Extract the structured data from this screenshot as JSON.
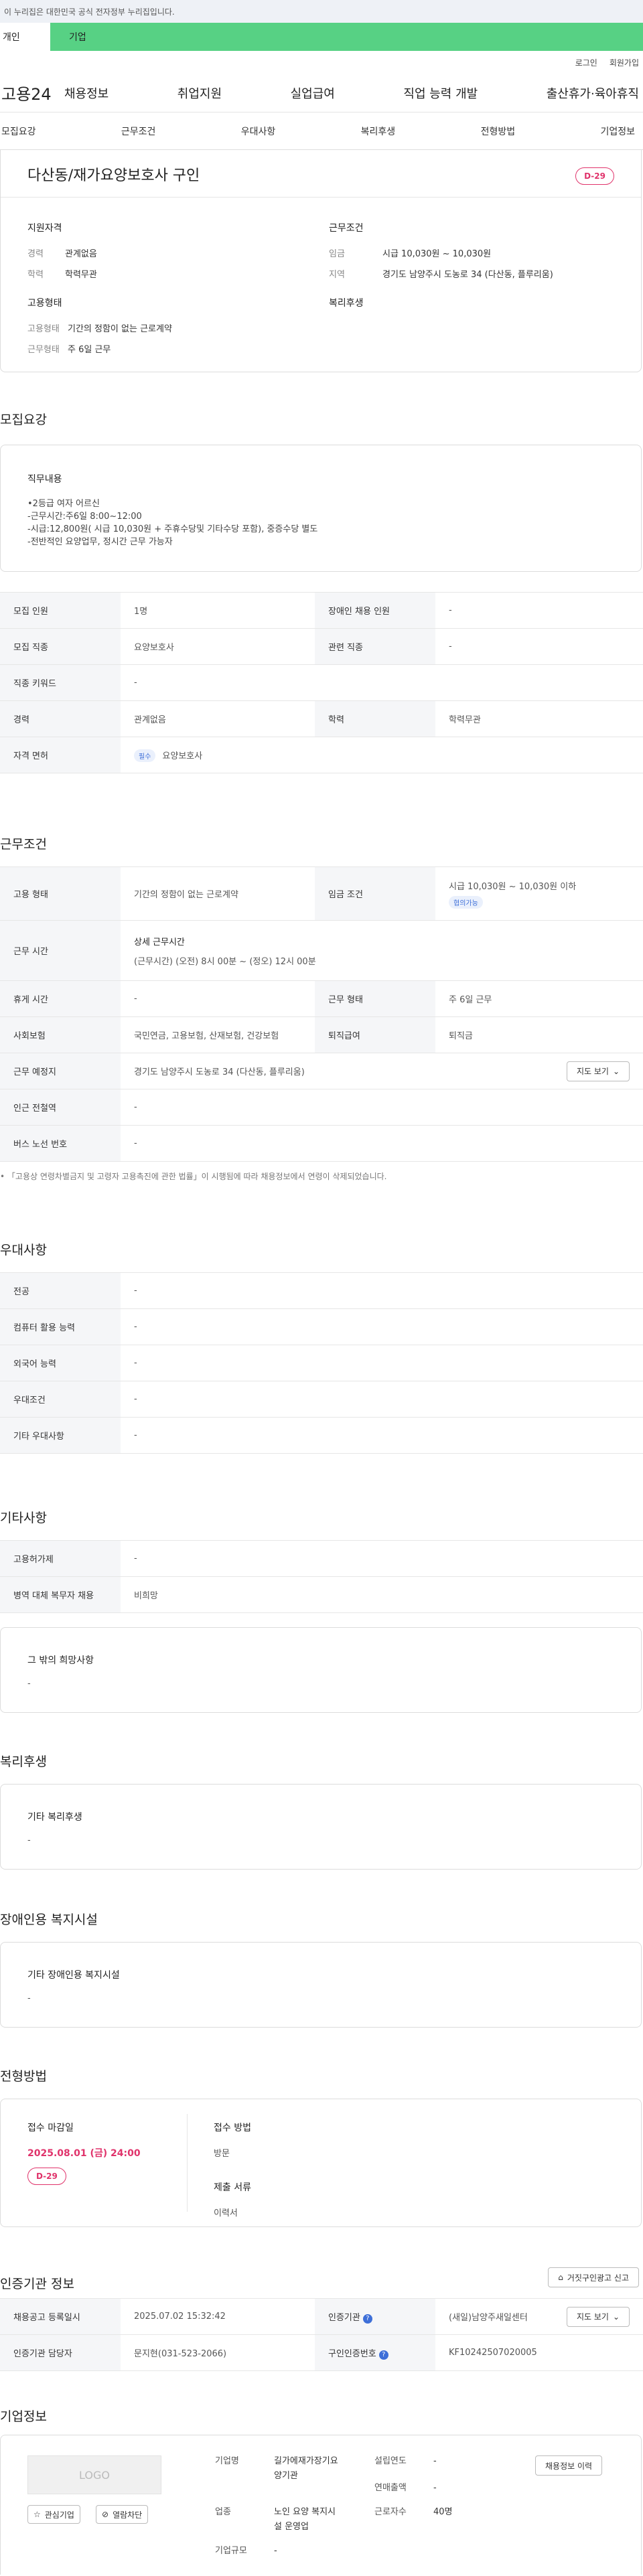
{
  "gov_banner": "이 누리집은 대한민국 공식 전자정부 누리집입니다.",
  "tabs": [
    "개인",
    "기업"
  ],
  "util": [
    "로그인",
    "회원가입"
  ],
  "logo": "고용24",
  "gnb": [
    "채용정보",
    "취업지원",
    "실업급여",
    "직업 능력 개발",
    "출산휴가·육아휴직"
  ],
  "snb": [
    "모집요강",
    "근무조건",
    "우대사항",
    "복리후생",
    "전형방법",
    "기업정보"
  ],
  "summary": {
    "title": "다산동/재가요양보호사 구인",
    "dday": "D-29",
    "qual_title": "지원자격",
    "career_k": "경력",
    "career_v": "관계없음",
    "edu_k": "학력",
    "edu_v": "학력무관",
    "emp_title": "고용형태",
    "emptype_k": "고용형태",
    "emptype_v": "기간의 정함이 없는 근로계약",
    "worktype_k": "근무형태",
    "worktype_v": "주 6일 근무",
    "cond_title": "근무조건",
    "wage_k": "임금",
    "wage_v": "시급 10,030원 ~ 10,030원",
    "region_k": "지역",
    "region_v": "경기도 남양주시 도농로 34 (다산동, 플루리움)",
    "welfare_title": "복리후생"
  },
  "recruit": {
    "heading": "모집요강",
    "duty_title": "직무내용",
    "duty_lines": [
      "•2등급 여자 어르신",
      "-근무시간:주6일 8:00~12:00",
      "-시급:12,800원( 시급 10,030원 + 주휴수당및 기타수당 포함), 중증수당 별도",
      "-전반적인 요양업무, 정시간 근무 가능자"
    ],
    "rows": [
      [
        "모집 인원",
        "1명",
        "장애인 채용 인원",
        "-"
      ],
      [
        "모집 직종",
        "요양보호사",
        "관련 직종",
        "-"
      ],
      [
        "직종 키워드",
        "-"
      ],
      [
        "경력",
        "관계없음",
        "학력",
        "학력무관"
      ],
      [
        "자격 면허",
        "요양보호사"
      ]
    ],
    "license_pill": "필수"
  },
  "work": {
    "heading": "근무조건",
    "emptype_h": "고용 형태",
    "emptype_v": "기간의 정함이 없는 근로계약",
    "wage_h": "임금 조건",
    "wage_v": "시급 10,030원 ~ 10,030원 이하",
    "wage_pill": "협의가능",
    "hours_h": "근무 시간",
    "hours_t": "상세 근무시간",
    "hours_v": "(근무시간) (오전) 8시 00분 ~ (정오) 12시 00분",
    "break_h": "휴게 시간",
    "break_v": "-",
    "form_h": "근무 형태",
    "form_v": "주 6일 근무",
    "ins_h": "사회보험",
    "ins_v": "국민연금, 고용보험, 산재보험, 건강보험",
    "ret_h": "퇴직급여",
    "ret_v": "퇴직금",
    "place_h": "근무 예정지",
    "place_v": "경기도 남양주시 도농로 34 (다산동, 플루리움)",
    "map_btn": "지도 보기",
    "subway_h": "인근 전철역",
    "subway_v": "-",
    "bus_h": "버스 노선 번호",
    "bus_v": "-",
    "note": "「고용상 연령차별금지 및 고령자 고용촉진에 관한 법률」이 시행됨에 따라 채용정보에서 연령이 삭제되었습니다."
  },
  "pref": {
    "heading": "우대사항",
    "rows": [
      [
        "전공",
        "-"
      ],
      [
        "컴퓨터 활용 능력",
        "-"
      ],
      [
        "외국어 능력",
        "-"
      ],
      [
        "우대조건",
        "-"
      ],
      [
        "기타 우대사항",
        "-"
      ]
    ]
  },
  "etc": {
    "heading": "기타사항",
    "rows": [
      [
        "고용허가제",
        "-"
      ],
      [
        "병역 대체 복무자 채용",
        "비희망"
      ]
    ],
    "other_title": "그 밖의 희망사항",
    "other_v": "-"
  },
  "welfare": {
    "heading": "복리후생",
    "title": "기타 복리후생",
    "v": "-"
  },
  "disab": {
    "heading": "장애인용 복지시설",
    "title": "기타 장애인용 복지시설",
    "v": "-"
  },
  "select": {
    "heading": "전형방법",
    "deadline_t": "접수 마감일",
    "deadline_v": "2025.08.01 (금) 24:00",
    "dday": "D-29",
    "method_t": "접수 방법",
    "method_v": "방문",
    "docs_t": "제출 서류",
    "docs_v": "이력서"
  },
  "auth": {
    "heading": "인증기관 정보",
    "report_btn": "거짓구인광고 신고",
    "reg_h": "채용공고 등록일시",
    "reg_v": "2025.07.02 15:32:42",
    "org_h": "인증기관",
    "org_v": "(새일)남양주새일센터",
    "map_btn": "지도 보기",
    "mgr_h": "인증기관 담당자",
    "mgr_v": "문지현(031-523-2066)",
    "num_h": "구인인증번호",
    "num_v": "KF10242507020005"
  },
  "company": {
    "heading": "기업정보",
    "logo": "LOGO",
    "fav_btn": "관심기업",
    "block_btn": "열람차단",
    "name_k": "기업명",
    "name_v": [
      "길가에재가장기요",
      "양기관"
    ],
    "year_k": "설립연도",
    "year_v": "-",
    "sales_k": "연매출액",
    "sales_v": "-",
    "biz_k": "업종",
    "biz_v": [
      "노인 요양 복지시",
      "설 운영업"
    ],
    "emp_k": "근로자수",
    "emp_v": "40명",
    "size_k": "기업규모",
    "size_v": "-",
    "hist_btn": "채용정보 이력"
  }
}
